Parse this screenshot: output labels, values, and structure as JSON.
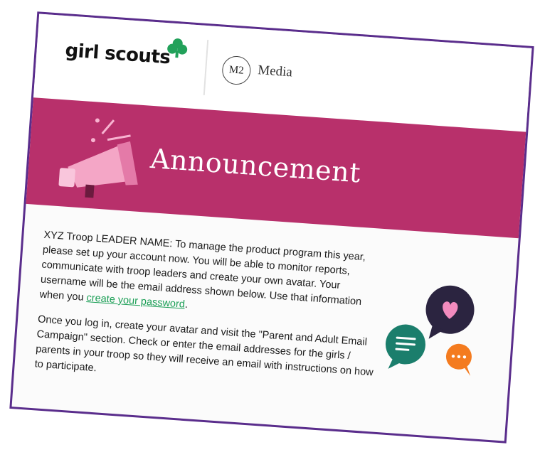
{
  "brand": {
    "girl_scouts": "girl scouts",
    "m2_mark": "M2",
    "m2_name": "Media",
    "clover_color": "#22a15a"
  },
  "banner": {
    "title": "Announcement",
    "color": "#b8306b"
  },
  "body": {
    "para1_text": "XYZ Troop LEADER NAME: To manage the product program this year, please set up your account now. You will be able to monitor reports, communicate with troop leaders and create your own avatar. Your username will be the email address shown below. Use that information when you ",
    "para1_link": "create your password",
    "para1_end": ".",
    "para2_text": "Once you log in, create your avatar and visit the \"Parent and Adult Email Campaign\" section. Check or enter the email addresses for the girls / parents in your troop so they will receive an email with instructions on how to participate."
  },
  "colors": {
    "frame": "#5a2d8c",
    "link": "#1a9e55"
  },
  "icons": [
    "clover-icon",
    "megaphone-icon",
    "chat-bubbles-icon"
  ]
}
